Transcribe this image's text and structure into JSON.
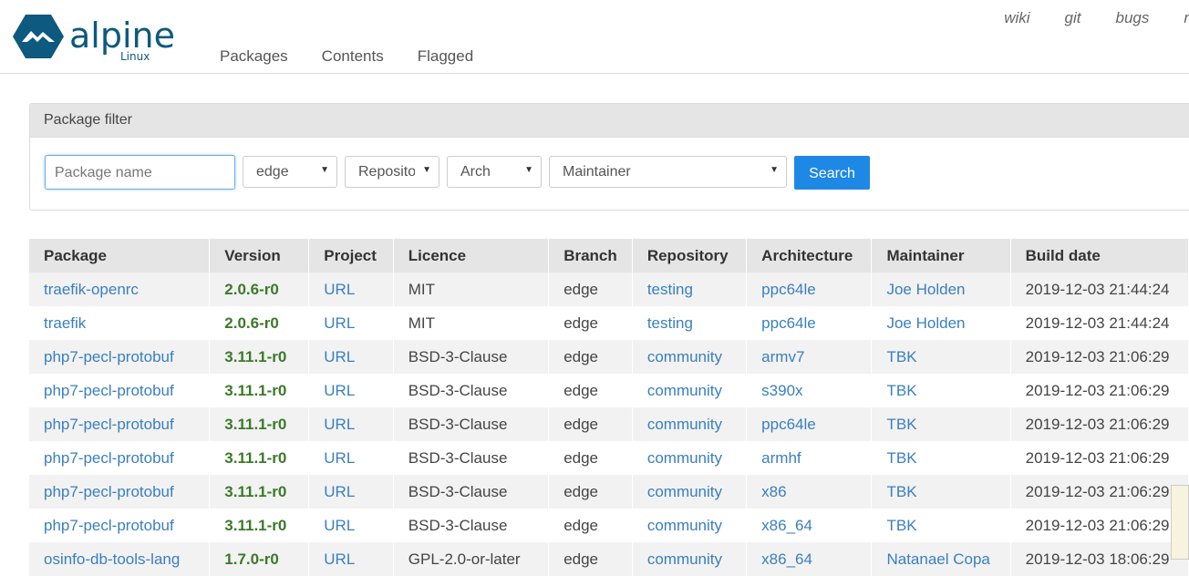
{
  "brand": {
    "name": "alpine",
    "sub": "Linux"
  },
  "nav": [
    "Packages",
    "Contents",
    "Flagged"
  ],
  "toplinks": [
    "wiki",
    "git",
    "bugs",
    "mir"
  ],
  "filter": {
    "title": "Package filter",
    "name_placeholder": "Package name",
    "branch": "edge",
    "repo": "Repository",
    "arch": "Arch",
    "maintainer": "Maintainer",
    "search_label": "Search"
  },
  "table": {
    "headers": [
      "Package",
      "Version",
      "Project",
      "Licence",
      "Branch",
      "Repository",
      "Architecture",
      "Maintainer",
      "Build date"
    ],
    "rows": [
      [
        "traefik-openrc",
        "2.0.6-r0",
        "URL",
        "MIT",
        "edge",
        "testing",
        "ppc64le",
        "Joe Holden",
        "2019-12-03 21:44:24"
      ],
      [
        "traefik",
        "2.0.6-r0",
        "URL",
        "MIT",
        "edge",
        "testing",
        "ppc64le",
        "Joe Holden",
        "2019-12-03 21:44:24"
      ],
      [
        "php7-pecl-protobuf",
        "3.11.1-r0",
        "URL",
        "BSD-3-Clause",
        "edge",
        "community",
        "armv7",
        "TBK",
        "2019-12-03 21:06:29"
      ],
      [
        "php7-pecl-protobuf",
        "3.11.1-r0",
        "URL",
        "BSD-3-Clause",
        "edge",
        "community",
        "s390x",
        "TBK",
        "2019-12-03 21:06:29"
      ],
      [
        "php7-pecl-protobuf",
        "3.11.1-r0",
        "URL",
        "BSD-3-Clause",
        "edge",
        "community",
        "ppc64le",
        "TBK",
        "2019-12-03 21:06:29"
      ],
      [
        "php7-pecl-protobuf",
        "3.11.1-r0",
        "URL",
        "BSD-3-Clause",
        "edge",
        "community",
        "armhf",
        "TBK",
        "2019-12-03 21:06:29"
      ],
      [
        "php7-pecl-protobuf",
        "3.11.1-r0",
        "URL",
        "BSD-3-Clause",
        "edge",
        "community",
        "x86",
        "TBK",
        "2019-12-03 21:06:29"
      ],
      [
        "php7-pecl-protobuf",
        "3.11.1-r0",
        "URL",
        "BSD-3-Clause",
        "edge",
        "community",
        "x86_64",
        "TBK",
        "2019-12-03 21:06:29"
      ],
      [
        "osinfo-db-tools-lang",
        "1.7.0-r0",
        "URL",
        "GPL-2.0-or-later",
        "edge",
        "community",
        "x86_64",
        "Natanael Copa",
        "2019-12-03 18:06:29"
      ]
    ]
  },
  "colors": {
    "link": "#3a7fbf",
    "version": "#3b7a2a",
    "brand": "#0d597f",
    "button": "#1e88e5"
  }
}
